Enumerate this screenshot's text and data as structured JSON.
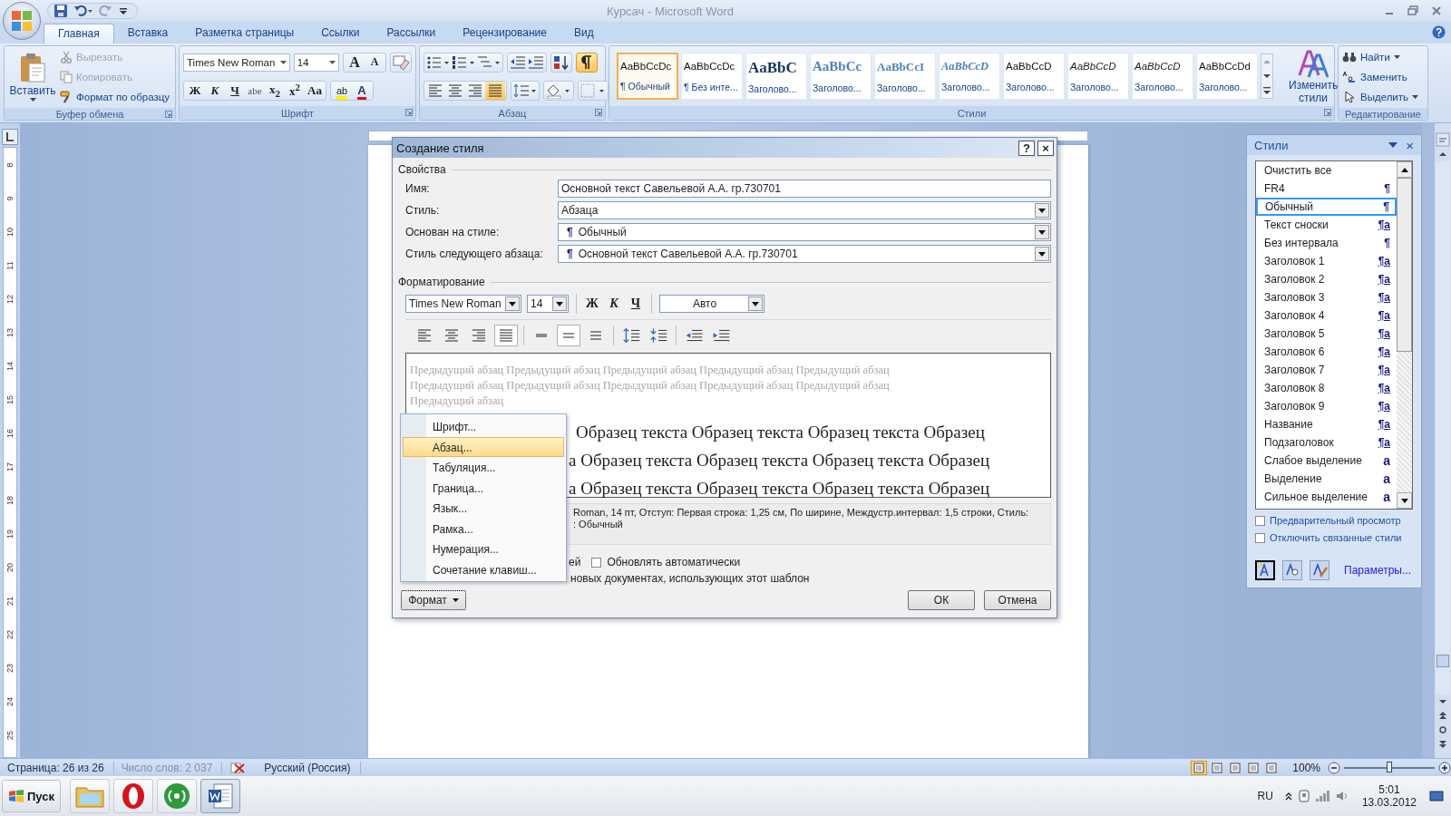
{
  "window": {
    "title": "Курсач - Microsoft Word"
  },
  "tabs": [
    {
      "label": "Главная",
      "selected": true
    },
    {
      "label": "Вставка",
      "selected": false
    },
    {
      "label": "Разметка страницы",
      "selected": false
    },
    {
      "label": "Ссылки",
      "selected": false
    },
    {
      "label": "Рассылки",
      "selected": false
    },
    {
      "label": "Рецензирование",
      "selected": false
    },
    {
      "label": "Вид",
      "selected": false
    }
  ],
  "clipboard": {
    "title": "Буфер обмена",
    "paste": "Вставить",
    "items": [
      {
        "label": "Вырезать",
        "disabled": true
      },
      {
        "label": "Копировать",
        "disabled": true
      },
      {
        "label": "Формат по образцу",
        "disabled": false
      }
    ]
  },
  "font": {
    "title": "Шрифт",
    "name": "Times New Roman",
    "size": "14",
    "grow": "A",
    "shrink": "A",
    "buttons": [
      {
        "label": "Ж",
        "kind": "bold"
      },
      {
        "label": "К",
        "kind": "italic"
      },
      {
        "label": "Ч",
        "kind": "underline"
      },
      {
        "label": "abe",
        "kind": "strike"
      },
      {
        "label": "x$_{2}$",
        "kind": "plain"
      },
      {
        "label": "x$^{2}$",
        "kind": "plain"
      },
      {
        "label": "Aa",
        "kind": "plain"
      }
    ],
    "highlight": "ab",
    "color_button": "A"
  },
  "paragraph": {
    "title": "Абзац",
    "show_marks": true,
    "align": [
      {
        "selected": false
      },
      {
        "selected": false
      },
      {
        "selected": false
      },
      {
        "selected": true
      }
    ]
  },
  "styles": {
    "title": "Стили",
    "change": "Изменить стили",
    "gallery": [
      {
        "preview": "AaBbCcDc",
        "label": "¶ Обычный",
        "kind": "plain",
        "selected": true
      },
      {
        "preview": "AaBbCcDc",
        "label": "¶ Без инте...",
        "kind": "plain",
        "selected": false
      },
      {
        "preview": "AaBbC",
        "label": "Заголово...",
        "kind": "title",
        "selected": false
      },
      {
        "preview": "AaBbCc",
        "label": "Заголово...",
        "kind": "heading",
        "selected": false
      },
      {
        "preview": "AaBbCcI",
        "label": "Заголово...",
        "kind": "heading-small",
        "selected": false
      },
      {
        "preview": "AaBbCcD",
        "label": "Заголово...",
        "kind": "heading-italic",
        "selected": false
      },
      {
        "preview": "AaBbCcD",
        "label": "Заголово...",
        "kind": "plain",
        "selected": false
      },
      {
        "preview": "AaBbCcD",
        "label": "Заголово...",
        "kind": "italic",
        "selected": false
      },
      {
        "preview": "AaBbCcD",
        "label": "Заголово...",
        "kind": "italic",
        "selected": false
      },
      {
        "preview": "AaBbCcDd",
        "label": "Заголово...",
        "kind": "plain",
        "selected": false
      }
    ]
  },
  "editing": {
    "title": "Редактирование",
    "items": [
      {
        "label": "Найти",
        "dropdown": true
      },
      {
        "label": "Заменить",
        "dropdown": false
      },
      {
        "label": "Выделить",
        "dropdown": true
      }
    ]
  },
  "ruler": {
    "numbers": [
      "8",
      "9",
      "10",
      "11",
      "12",
      "13",
      "14",
      "15",
      "16",
      "17",
      "18",
      "19",
      "20",
      "21",
      "22",
      "23",
      "24",
      "25"
    ]
  },
  "dialog": {
    "title": "Создание стиля",
    "help": "?",
    "close": "×",
    "properties_title": "Свойства",
    "fields": [
      {
        "label": "Имя:",
        "value": "Основной текст Савельевой А.А. гр.730701",
        "kind": "text"
      },
      {
        "label": "Стиль:",
        "value": "Абзаца",
        "kind": "select"
      },
      {
        "label": "Основан на стиле:",
        "mark": "¶",
        "value": "Обычный",
        "kind": "select"
      },
      {
        "label": "Стиль следующего абзаца:",
        "mark": "¶",
        "value": "Основной текст Савельевой А.А. гр.730701",
        "kind": "select"
      }
    ],
    "formatting_title": "Форматирование",
    "font": "Times New Roman",
    "size": "14",
    "style_buttons": [
      {
        "label": "Ж",
        "kind": "bold"
      },
      {
        "label": "К",
        "kind": "italic"
      },
      {
        "label": "Ч",
        "kind": "underline"
      }
    ],
    "font_color": "Авто",
    "align": [
      {
        "selected": false
      },
      {
        "selected": false
      },
      {
        "selected": false
      },
      {
        "selected": true
      }
    ],
    "spacing": [
      {
        "selected": false
      },
      {
        "selected": true
      },
      {
        "selected": false
      }
    ],
    "previous_lines": [
      "Предыдущий абзац Предыдущий абзац Предыдущий абзац Предыдущий абзац Предыдущий абзац",
      "Предыдущий абзац Предыдущий абзац Предыдущий абзац Предыдущий абзац Предыдущий абзац",
      "Предыдущий абзац"
    ],
    "sample_lines": [
      "Образец текста Образец текста Образец текста Образец",
      "а Образец текста Образец текста Образец текста Образец",
      "а Образец текста Образец текста Образец текста Образец"
    ],
    "description": [
      "Roman, 14 пт, Отступ: Первая строка:  1,25 см, По ширине, Междустр.интервал:  1,5 строки, Стиль:",
      ": Обычный"
    ],
    "add_tail": "ей",
    "auto_update": {
      "label": "Обновлять автоматически",
      "checked": false
    },
    "template_tail": "новых документах, использующих этот шаблон",
    "format_button": "Формат",
    "ok": "ОК",
    "cancel": "Отмена",
    "format_menu": [
      {
        "label": "Шрифт...",
        "selected": false
      },
      {
        "label": "Абзац...",
        "selected": true
      },
      {
        "label": "Табуляция...",
        "selected": false
      },
      {
        "label": "Граница...",
        "selected": false
      },
      {
        "label": "Язык...",
        "selected": false
      },
      {
        "label": "Рамка...",
        "selected": false
      },
      {
        "label": "Нумерация...",
        "selected": false
      },
      {
        "label": "Сочетание клавиш...",
        "selected": false
      }
    ]
  },
  "styles_pane": {
    "title": "Стили",
    "close": "×",
    "items": [
      {
        "label": "Очистить все",
        "selected": false
      },
      {
        "label": "FR4",
        "mark": "¶",
        "kind": "paragraph",
        "selected": false
      },
      {
        "label": "Обычный",
        "mark": "¶",
        "kind": "paragraph",
        "selected": true
      },
      {
        "label": "Текст сноски",
        "mark": "¶a",
        "kind": "linked",
        "selected": false
      },
      {
        "label": "Без интервала",
        "mark": "¶",
        "kind": "paragraph",
        "selected": false
      },
      {
        "label": "Заголовок 1",
        "mark": "¶a",
        "kind": "linked",
        "selected": false
      },
      {
        "label": "Заголовок 2",
        "mark": "¶a",
        "kind": "linked",
        "selected": false
      },
      {
        "label": "Заголовок 3",
        "mark": "¶a",
        "kind": "linked",
        "selected": false
      },
      {
        "label": "Заголовок 4",
        "mark": "¶a",
        "kind": "linked",
        "selected": false
      },
      {
        "label": "Заголовок 5",
        "mark": "¶a",
        "kind": "linked",
        "selected": false
      },
      {
        "label": "Заголовок 6",
        "mark": "¶a",
        "kind": "linked",
        "selected": false
      },
      {
        "label": "Заголовок 7",
        "mark": "¶a",
        "kind": "linked",
        "selected": false
      },
      {
        "label": "Заголовок 8",
        "mark": "¶a",
        "kind": "linked",
        "selected": false
      },
      {
        "label": "Заголовок 9",
        "mark": "¶a",
        "kind": "linked",
        "selected": false
      },
      {
        "label": "Название",
        "mark": "¶a",
        "kind": "linked",
        "selected": false
      },
      {
        "label": "Подзаголовок",
        "mark": "¶a",
        "kind": "linked",
        "selected": false
      },
      {
        "label": "Слабое выделение",
        "mark": "a",
        "kind": "character",
        "selected": false
      },
      {
        "label": "Выделение",
        "mark": "a",
        "kind": "character",
        "selected": false
      },
      {
        "label": "Сильное выделение",
        "mark": "a",
        "kind": "character",
        "selected": false
      }
    ],
    "options": [
      {
        "label": "Предварительный просмотр",
        "checked": false
      },
      {
        "label": "Отключить связанные стили",
        "checked": false
      }
    ],
    "link": "Параметры..."
  },
  "status_bar": {
    "page": "Страница: 26 из 26",
    "words": "Число слов: 2 037",
    "language": "Русский (Россия)",
    "views": [
      {
        "selected": true
      },
      {
        "selected": false
      },
      {
        "selected": false
      },
      {
        "selected": false
      },
      {
        "selected": false
      }
    ],
    "zoom": "100%",
    "zoom_slider": {
      "level": 0.5
    }
  },
  "taskbar": {
    "start": "Пуск",
    "apps": [
      {
        "kind": "folder",
        "selected": false
      },
      {
        "kind": "opera",
        "selected": false
      },
      {
        "kind": "radio",
        "selected": false
      },
      {
        "kind": "word",
        "selected": true
      }
    ],
    "language": "RU",
    "time": "5:01",
    "date": "13.03.2012"
  }
}
